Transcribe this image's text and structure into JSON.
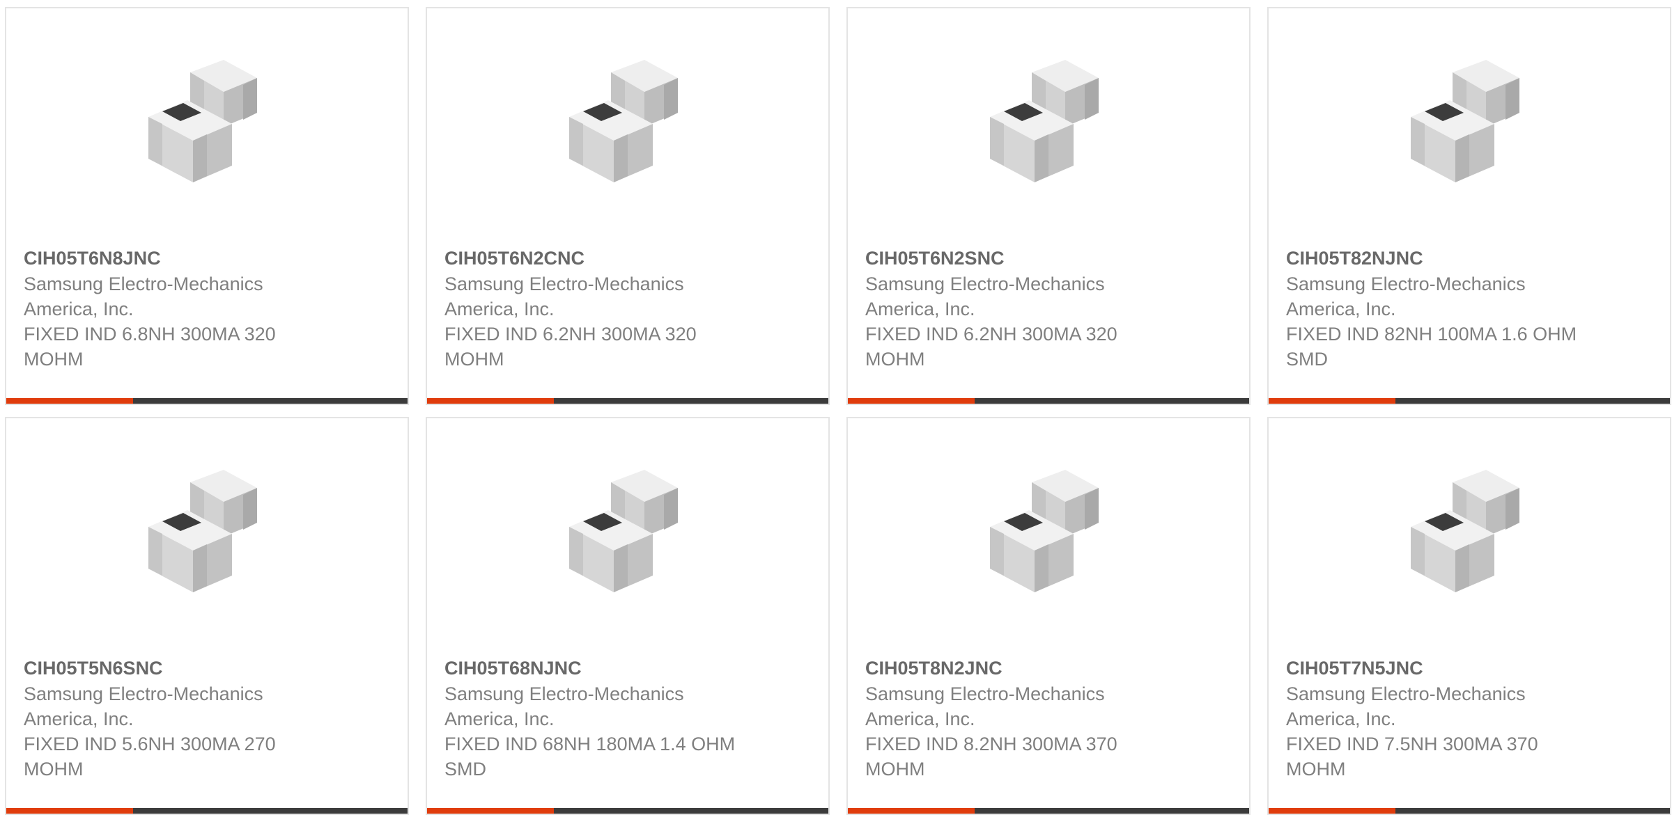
{
  "products": [
    {
      "part_number": "CIH05T6N8JNC",
      "manufacturer": "Samsung Electro-Mechanics America, Inc.",
      "description": "FIXED IND 6.8NH 300MA 320 MOHM",
      "image_icon": "smd-inductor-image"
    },
    {
      "part_number": "CIH05T6N2CNC",
      "manufacturer": "Samsung Electro-Mechanics America, Inc.",
      "description": "FIXED IND 6.2NH 300MA 320 MOHM",
      "image_icon": "smd-inductor-image"
    },
    {
      "part_number": "CIH05T6N2SNC",
      "manufacturer": "Samsung Electro-Mechanics America, Inc.",
      "description": "FIXED IND 6.2NH 300MA 320 MOHM",
      "image_icon": "smd-inductor-image"
    },
    {
      "part_number": "CIH05T82NJNC",
      "manufacturer": "Samsung Electro-Mechanics America, Inc.",
      "description": "FIXED IND 82NH 100MA 1.6 OHM SMD",
      "image_icon": "smd-inductor-image"
    },
    {
      "part_number": "CIH05T5N6SNC",
      "manufacturer": "Samsung Electro-Mechanics America, Inc.",
      "description": "FIXED IND 5.6NH 300MA 270 MOHM",
      "image_icon": "smd-inductor-image"
    },
    {
      "part_number": "CIH05T68NJNC",
      "manufacturer": "Samsung Electro-Mechanics America, Inc.",
      "description": "FIXED IND 68NH 180MA 1.4 OHM SMD",
      "image_icon": "smd-inductor-image"
    },
    {
      "part_number": "CIH05T8N2JNC",
      "manufacturer": "Samsung Electro-Mechanics America, Inc.",
      "description": "FIXED IND 8.2NH 300MA 370 MOHM",
      "image_icon": "smd-inductor-image"
    },
    {
      "part_number": "CIH05T7N5JNC",
      "manufacturer": "Samsung Electro-Mechanics America, Inc.",
      "description": "FIXED IND 7.5NH 300MA 370 MOHM",
      "image_icon": "smd-inductor-image"
    }
  ],
  "colors": {
    "accent": "#e03c0c",
    "bar": "#3b3b3b",
    "border": "#e4e4e4",
    "part_text": "#686868",
    "body_text": "#7f7f7f"
  }
}
